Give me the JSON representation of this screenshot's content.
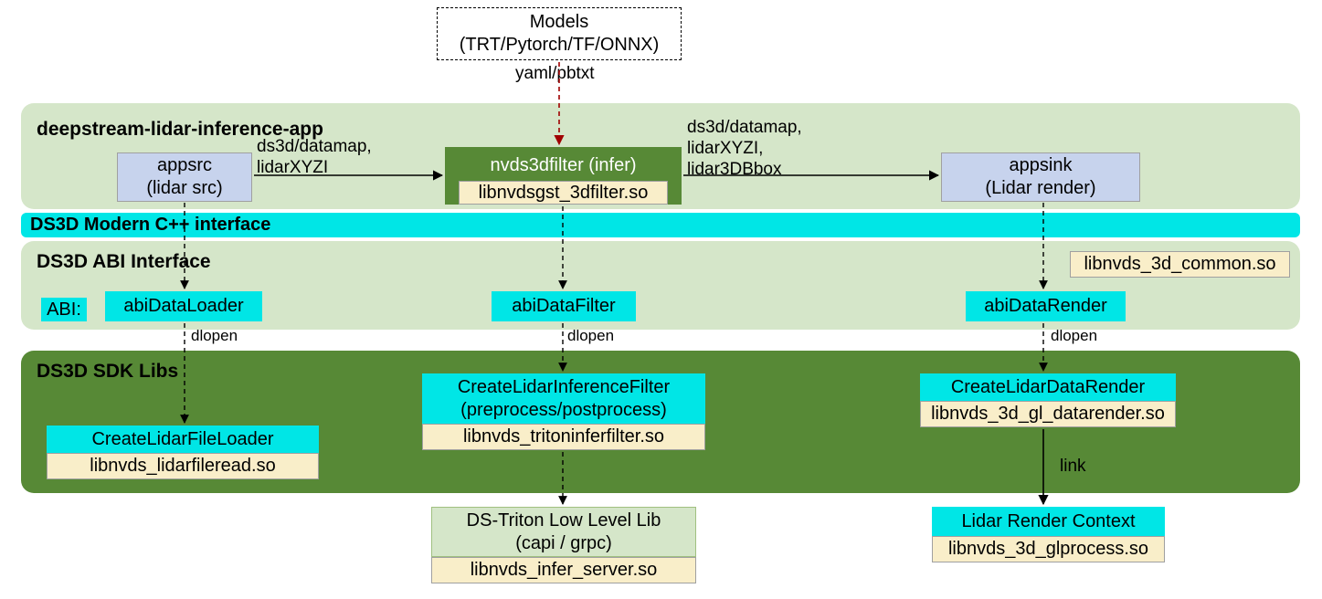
{
  "chart_data": {
    "type": "diagram",
    "title": "deepstream-lidar-inference-app architecture",
    "layers": [
      {
        "name": "Models",
        "detail": "(TRT/Pytorch/TF/ONNX)",
        "output_format": "yaml/pbtxt"
      },
      {
        "name": "deepstream-lidar-inference-app",
        "elements": [
          {
            "name": "appsrc",
            "detail": "(lidar src)"
          },
          {
            "name": "nvds3dfilter (infer)",
            "lib": "libnvdsgst_3dfilter.so"
          },
          {
            "name": "appsink",
            "detail": "(Lidar render)"
          }
        ],
        "edges": [
          {
            "from": "appsrc",
            "to": "nvds3dfilter",
            "label": "ds3d/datamap, lidarXYZI"
          },
          {
            "from": "nvds3dfilter",
            "to": "appsink",
            "label": "ds3d/datamap, lidarXYZI, lidar3DBbox"
          }
        ]
      },
      {
        "name": "DS3D Modern C++ interface"
      },
      {
        "name": "DS3D ABI  Interface",
        "abi_label": "ABI:",
        "lib": "libnvds_3d_common.so",
        "elements": [
          "abiDataLoader",
          "abiDataFilter",
          "abiDataRender"
        ]
      },
      {
        "name": "DS3D SDK Libs",
        "elements": [
          {
            "name": "CreateLidarFileLoader",
            "lib": "libnvds_lidarfileread.so"
          },
          {
            "name": "CreateLidarInferenceFilter",
            "detail": "(preprocess/postprocess)",
            "lib": "libnvds_tritoninferfilter.so"
          },
          {
            "name": "CreateLidarDataRender",
            "lib": "libnvds_3d_gl_datarender.so"
          }
        ]
      },
      {
        "name": "DS-Triton Low Level Lib",
        "detail": "(capi / grpc)",
        "lib": "libnvds_infer_server.so"
      },
      {
        "name": "Lidar Render Context",
        "lib": "libnvds_3d_glprocess.so"
      }
    ],
    "vertical_edges": [
      {
        "from": "Models",
        "to": "nvds3dfilter",
        "style": "dashed",
        "color": "red"
      },
      {
        "from": "appsrc",
        "to": "abiDataLoader",
        "style": "dashed",
        "label": ""
      },
      {
        "from": "nvds3dfilter",
        "to": "abiDataFilter",
        "style": "dashed"
      },
      {
        "from": "appsink",
        "to": "abiDataRender",
        "style": "dashed"
      },
      {
        "from": "abiDataLoader",
        "to": "CreateLidarFileLoader",
        "style": "dashed",
        "label": "dlopen"
      },
      {
        "from": "abiDataFilter",
        "to": "CreateLidarInferenceFilter",
        "style": "dashed",
        "label": "dlopen"
      },
      {
        "from": "abiDataRender",
        "to": "CreateLidarDataRender",
        "style": "dashed",
        "label": "dlopen"
      },
      {
        "from": "CreateLidarInferenceFilter",
        "to": "DS-Triton Low Level Lib",
        "style": "dashed"
      },
      {
        "from": "CreateLidarDataRender",
        "to": "Lidar Render Context",
        "style": "solid",
        "label": "link"
      }
    ]
  },
  "models": {
    "line1": "Models",
    "line2": "(TRT/Pytorch/TF/ONNX)"
  },
  "models_fmt": "yaml/pbtxt",
  "app": {
    "title": "deepstream-lidar-inference-app"
  },
  "appsrc": {
    "line1": "appsrc",
    "line2": "(lidar src)"
  },
  "filter": {
    "title": "nvds3dfilter (infer)",
    "lib": "libnvdsgst_3dfilter.so"
  },
  "appsink": {
    "line1": "appsink",
    "line2": "(Lidar render)"
  },
  "edge1": {
    "line1": "ds3d/datamap,",
    "line2": "lidarXYZI"
  },
  "edge2": {
    "line1": "ds3d/datamap,",
    "line2": "lidarXYZI,",
    "line3": "lidar3DBbox"
  },
  "cpp_band": "DS3D Modern C++ interface",
  "abi": {
    "title": "DS3D ABI  Interface",
    "tag": "ABI:",
    "lib": "libnvds_3d_common.so",
    "loader": "abiDataLoader",
    "filter": "abiDataFilter",
    "render": "abiDataRender"
  },
  "dlopen": "dlopen",
  "sdk": {
    "title": "DS3D SDK Libs"
  },
  "loader": {
    "name": "CreateLidarFileLoader",
    "lib": "libnvds_lidarfileread.so"
  },
  "infer": {
    "line1": "CreateLidarInferenceFilter",
    "line2": "(preprocess/postprocess)",
    "lib": "libnvds_tritoninferfilter.so"
  },
  "render": {
    "name": "CreateLidarDataRender",
    "lib": "libnvds_3d_gl_datarender.so"
  },
  "triton": {
    "line1": "DS-Triton Low Level Lib",
    "line2": "(capi / grpc)",
    "lib": "libnvds_infer_server.so"
  },
  "link": "link",
  "context": {
    "name": "Lidar Render Context",
    "lib": "libnvds_3d_glprocess.so"
  }
}
